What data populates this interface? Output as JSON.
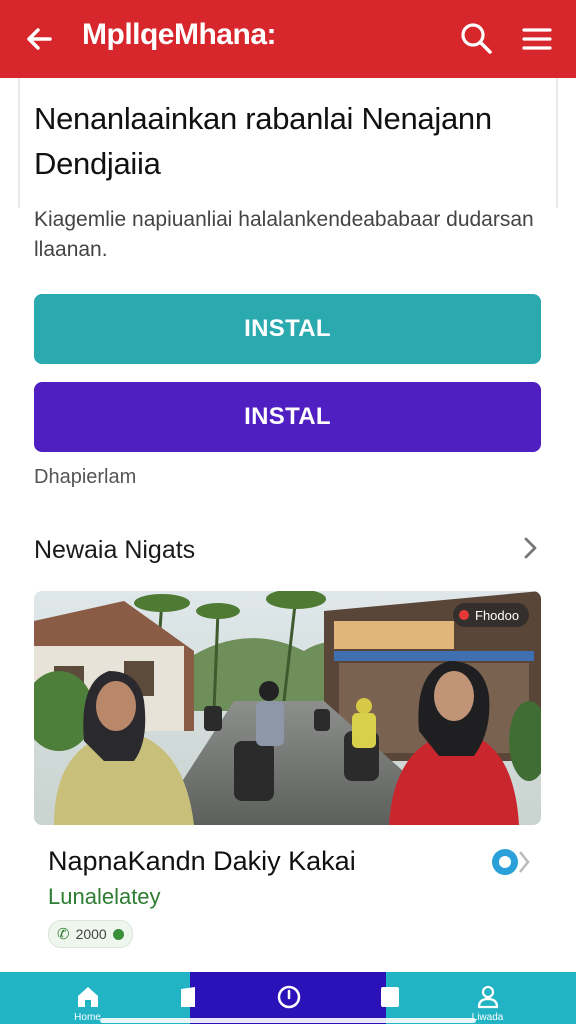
{
  "app_bar": {
    "title": "MpllqeMhana:",
    "background": "#d7262c"
  },
  "content": {
    "headline": "Nenanlaainkan rabanlai Nenajann Dendjaiia",
    "description": "Kiagemlie napiuanliai halalankendeababaar dudarsan llaanan.",
    "primary_button": "INSTAL",
    "secondary_button": "INSTAL",
    "note": "Dhapierlam"
  },
  "section": {
    "title": "Newaia Nigats"
  },
  "article": {
    "badge": "Fhodoo",
    "title": "NapnaKandn Dakiy Kakai",
    "subtitle": "Lunalelatey",
    "pill_text": "2000"
  },
  "bottom_nav": {
    "items": [
      {
        "label": "Home",
        "icon": "home-icon"
      },
      {
        "label": "",
        "icon": "bookmark-icon"
      },
      {
        "label": "",
        "icon": "clock-icon"
      },
      {
        "label": "",
        "icon": "square-icon"
      },
      {
        "label": "Liwada",
        "icon": "person-icon"
      }
    ]
  },
  "colors": {
    "teal_button": "#2aa9ae",
    "purple_button": "#4f1fc2",
    "nav_teal": "#22b3c4",
    "nav_blue": "#2a12b8"
  }
}
